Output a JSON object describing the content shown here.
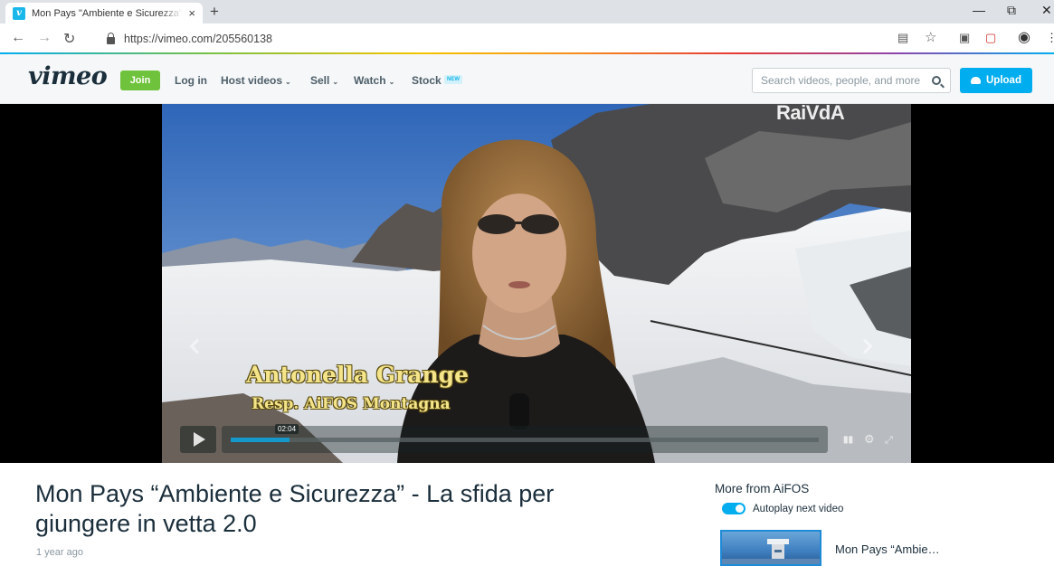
{
  "browser": {
    "tab_title": "Mon Pays \"Ambiente e Sicurezza\" - La sfida per giungere in vetta 2.0",
    "tab_close": "×",
    "new_tab": "+",
    "url": "https://vimeo.com/205560138",
    "favicon_letter": "v"
  },
  "header": {
    "logo": "vimeo",
    "join_label": "Join",
    "nav": [
      {
        "label": "Log in"
      },
      {
        "label": "Host videos"
      },
      {
        "label": "Sell"
      },
      {
        "label": "Watch"
      },
      {
        "label": "Stock"
      }
    ],
    "new_badge": "NEW",
    "search_placeholder": "Search videos, people, and more",
    "upload_label": "Upload"
  },
  "player": {
    "watermark": "RaiVdA",
    "lower_third_name": "Antonella Grange",
    "lower_third_role": "Resp. AiFOS Montagna",
    "time": "02:04",
    "progress_fraction": 0.09,
    "buffered_fraction": 0.1
  },
  "video": {
    "title": "Mon Pays “Ambiente e Sicurezza” - La sfida per giungere in vetta 2.0",
    "posted": "1 year ago"
  },
  "sidebar": {
    "title": "More from AiFOS",
    "autoplay_label": "Autoplay next video",
    "autoplay_on": true,
    "items": [
      {
        "title": "Mon Pays “Ambie…"
      }
    ]
  },
  "colors": {
    "accent": "#00adef",
    "join_green": "#6fc23b",
    "text_dark": "#1a2e3b"
  }
}
